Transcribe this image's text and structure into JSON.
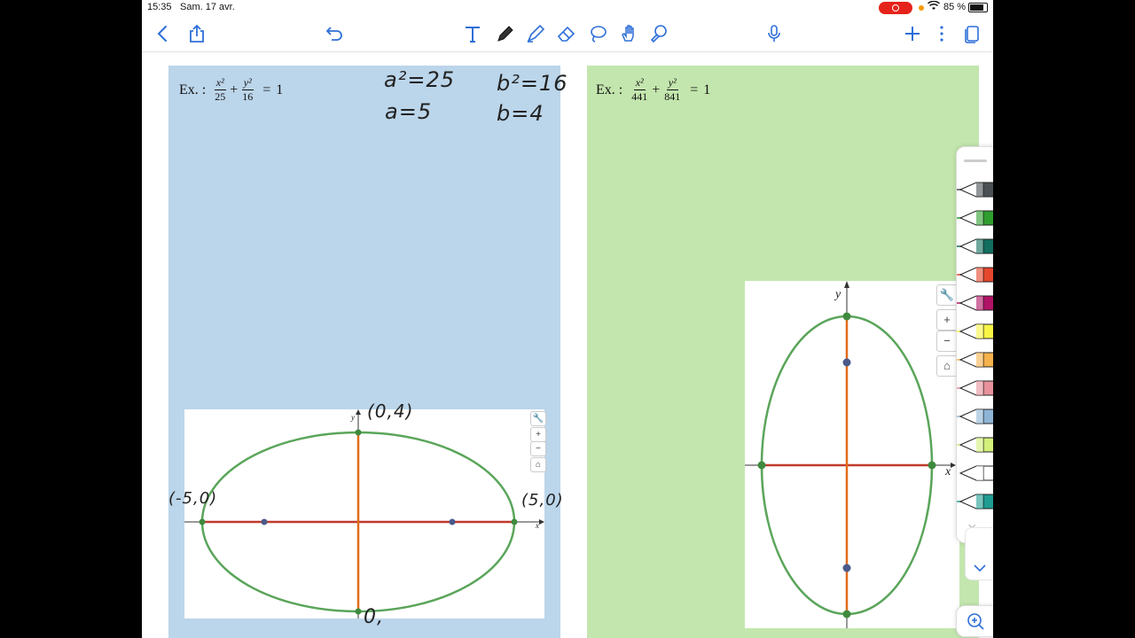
{
  "status": {
    "time": "15:35",
    "date": "Sam. 17 avr.",
    "battery": "85 %"
  },
  "toolbar": {
    "tools": [
      "back-icon",
      "share-icon",
      "undo-icon",
      "text-tool-icon",
      "pen-tool-icon",
      "highlighter-icon",
      "eraser-icon",
      "lasso-icon",
      "hand-tool-icon",
      "shapes-tool-icon",
      "microphone-icon",
      "add-icon",
      "more-icon",
      "pages-icon"
    ]
  },
  "left": {
    "eq_prefix": "Ex. :",
    "num1": "x²",
    "den1": "25",
    "plus": "+",
    "num2": "y²",
    "den2": "16",
    "eq": "=",
    "rhs": "1",
    "notes": {
      "a2": "a²=25",
      "a": "a=5",
      "b2": "b²=16",
      "b": "b=4"
    },
    "graph": {
      "top_label": "(0,4)",
      "left_label": "(-5,0)",
      "right_label": "(5,0)",
      "bottom_label": "0,",
      "x_axis": "x",
      "y_axis": "y",
      "controls": [
        "wrench-icon",
        "+",
        "−",
        "home-icon"
      ]
    }
  },
  "right": {
    "eq_prefix": "Ex. :",
    "num1": "x²",
    "den1": "441",
    "plus": "+",
    "num2": "y²",
    "den2": "841",
    "eq": "=",
    "rhs": "1",
    "graph": {
      "x_axis": "x",
      "y_axis": "y",
      "controls": [
        "wrench-icon",
        "+",
        "−",
        "home-icon"
      ]
    }
  },
  "palette": {
    "colors": [
      "#4a5054",
      "#2e9e2e",
      "#126e5e",
      "#e5462c",
      "#b11265",
      "#f8f545",
      "#f6b24c",
      "#e7919d",
      "#8fb5d6",
      "#d2f07a",
      "#ffffff",
      "#1f9c93"
    ],
    "close": "×"
  },
  "colors": {
    "blue_page": "#bbd5ea",
    "green_page": "#c3e6ae",
    "ellipse": "#5aa55a",
    "major_axis": "#c0392b",
    "minor_axis": "#e06b1a"
  }
}
